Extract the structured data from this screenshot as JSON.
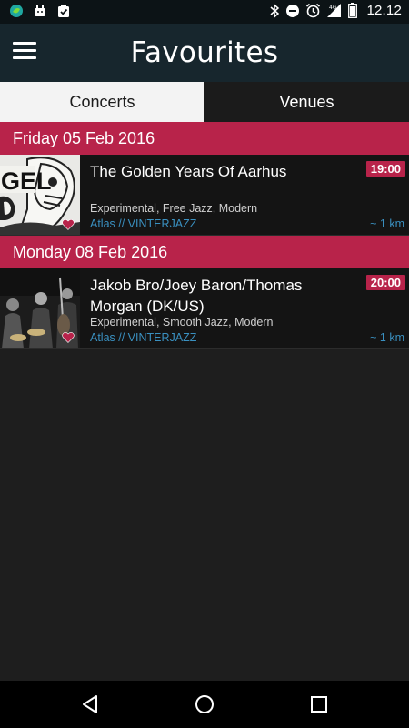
{
  "status_bar": {
    "time": "12.12",
    "icons": [
      "app-notification-icon",
      "android-icon",
      "clipboard-check-icon",
      "bluetooth-icon",
      "do-not-disturb-icon",
      "alarm-icon",
      "signal-4g-icon",
      "battery-icon"
    ]
  },
  "app_bar": {
    "title": "Favourites",
    "menu_icon": "hamburger-menu-icon"
  },
  "tabs": [
    {
      "label": "Concerts",
      "active": true
    },
    {
      "label": "Venues",
      "active": false
    }
  ],
  "sections": [
    {
      "date": "Friday 05 Feb 2016",
      "events": [
        {
          "title": "The Golden Years Of Aarhus",
          "time": "19:00",
          "genres": "Experimental, Free Jazz, Modern",
          "venue": "Atlas // VINTERJAZZ",
          "distance": "~ 1 km",
          "favourite": true,
          "thumb_text": "GEL"
        }
      ]
    },
    {
      "date": "Monday 08 Feb 2016",
      "events": [
        {
          "title": "Jakob Bro/Joey Baron/Thomas Morgan (DK/US)",
          "time": "20:00",
          "genres": "Experimental, Smooth Jazz, Modern",
          "venue": "Atlas // VINTERJAZZ",
          "distance": "~ 1 km",
          "favourite": true
        }
      ]
    }
  ],
  "nav_bar": {
    "icons": [
      "back-icon",
      "home-icon",
      "recents-icon"
    ]
  },
  "colors": {
    "accent": "#b8234a",
    "app_bar": "#17262d",
    "link": "#3a90c0",
    "background": "#1e1e1e"
  }
}
